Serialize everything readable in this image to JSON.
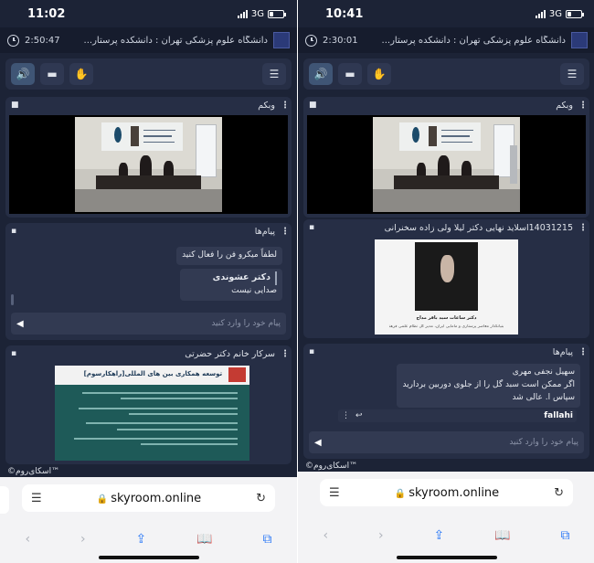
{
  "left": {
    "status": {
      "time": "11:02",
      "network": "3G",
      "battery_level": 0.25
    },
    "header": {
      "timer": "2:50:47",
      "title": "دانشگاه علوم پزشکی تهران : دانشکده پرستار..."
    },
    "webcam_panel": {
      "title": "وبکم"
    },
    "chat_panel": {
      "title": "پیام‌ها",
      "messages": [
        {
          "text": "لطفاً میکرو فن را فعال کنید"
        },
        {
          "name": "دکتر عشوندی",
          "text": "صدایی نیست"
        }
      ],
      "input_placeholder": "پیام خود را وارد کنید"
    },
    "slide_panel": {
      "title": "سرکار خانم دکتر حضرتی",
      "slide_title": "توسعه همکاری بین های المللی[راهکارسوم]"
    },
    "brand": "©اسکای‌روم™",
    "browser": {
      "url": "skyroom.online"
    }
  },
  "right": {
    "status": {
      "time": "10:41",
      "network": "3G",
      "battery_level": 0.25
    },
    "header": {
      "timer": "2:30:01",
      "title": "دانشگاه علوم پزشکی تهران : دانشکده پرستار..."
    },
    "webcam_panel": {
      "title": "وبکم"
    },
    "slide_panel": {
      "title": "14031215اسلاید نهایی دکتر لیلا ولی زاده سخنرانی",
      "caption": "دکتر ساعات سید باقر مداح",
      "subcaption": "بنیانگذار معاصر پرستاری و مامایی ایران، مدیر کل نظام علمی فرهنگی پرستاری و مامایی"
    },
    "chat_panel": {
      "title": "پیام‌ها",
      "message_lines": [
        "سهیل نجفی مهری",
        "اگر ممکن است سبد گل را از جلوی دوربین بردارید",
        "سپاس ا. عالی شد"
      ],
      "reply_to": "fallahi",
      "input_placeholder": "پیام خود را وارد کنید"
    },
    "brand": "©اسکای‌روم™",
    "browser": {
      "url": "skyroom.online"
    }
  },
  "icons": {
    "speaker": "speaker-icon",
    "whiteboard": "whiteboard-icon",
    "hand": "raise-hand-icon",
    "menu": "hamburger-menu-icon"
  },
  "colors": {
    "background": "#1c2336",
    "panel": "#262e45",
    "active_accent": "#55aef0",
    "link_blue": "#2f7bf6"
  }
}
